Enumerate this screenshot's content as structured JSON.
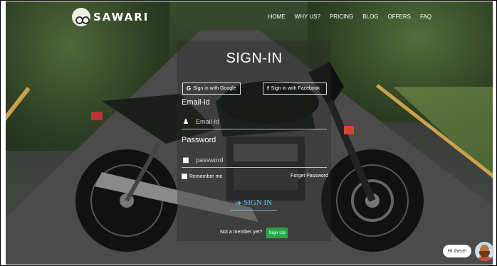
{
  "brand": {
    "name": "SAWARI"
  },
  "nav": {
    "items": [
      {
        "label": "HOME"
      },
      {
        "label": "WHY US?"
      },
      {
        "label": "PRICING"
      },
      {
        "label": "BLOG"
      },
      {
        "label": "OFFERS"
      },
      {
        "label": "FAQ"
      }
    ]
  },
  "signin": {
    "title": "SIGN-IN",
    "google_label": "Sign in with Google",
    "google_icon": "G",
    "facebook_label": "Sign in with Facebook",
    "facebook_icon": "f",
    "email_label": "Email-id",
    "email_placeholder": "Email-Id",
    "password_label": "Password",
    "password_placeholder": "password",
    "remember_label": "Remember me",
    "forgot_label": "Forget Password",
    "submit_label": "SIGN IN",
    "member_text": "Not a member yet?",
    "signup_label": "Sign Up"
  },
  "chat": {
    "greeting": "Hi there!"
  },
  "colors": {
    "signin_accent": "#5bc0de",
    "signup_green": "#28a745"
  }
}
